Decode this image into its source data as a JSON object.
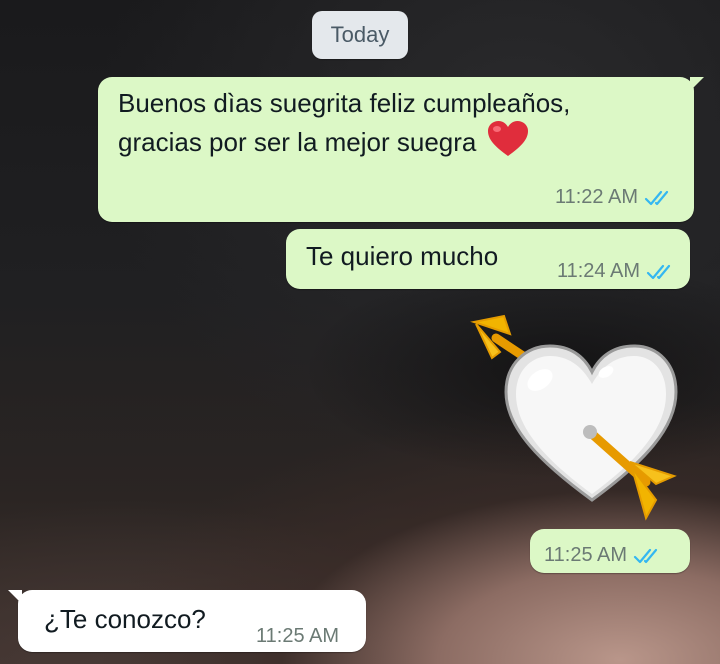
{
  "date_chip": {
    "label": "Today"
  },
  "messages": [
    {
      "direction": "outgoing",
      "line1": "Buenos dìas suegrita feliz cumpleaños,",
      "line2": "gracias por ser la mejor suegra",
      "emoji": "red-heart",
      "time": "11:22 AM",
      "status": "read"
    },
    {
      "direction": "outgoing",
      "text": "Te quiero mucho",
      "time": "11:24 AM",
      "status": "read"
    },
    {
      "direction": "outgoing",
      "sticker": "white-heart-with-arrow",
      "time": "11:25 AM",
      "status": "read"
    },
    {
      "direction": "incoming",
      "text": "¿Te conozco?",
      "time": "11:25 AM"
    }
  ],
  "colors": {
    "outgoing_bubble": "#dcf8c6",
    "incoming_bubble": "#ffffff",
    "date_chip": "#e4e8ec",
    "read_ticks": "#34b7f1",
    "timestamp": "#6b7a74"
  }
}
